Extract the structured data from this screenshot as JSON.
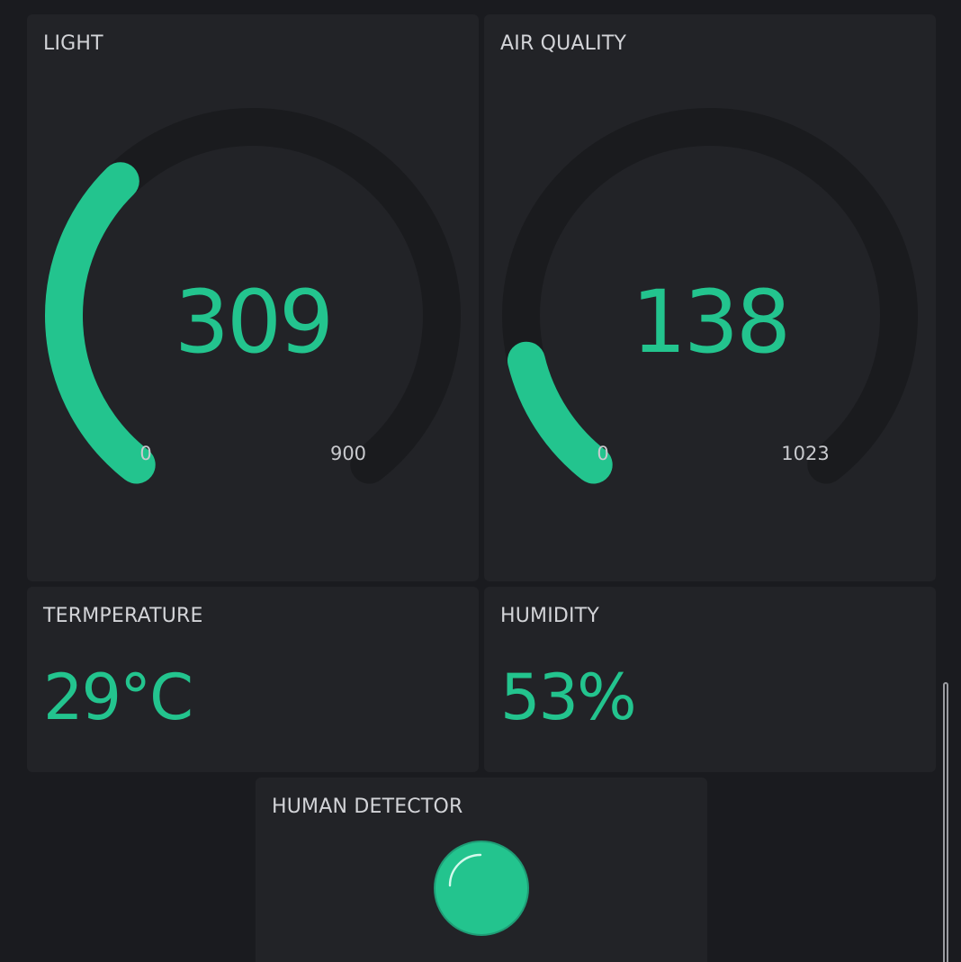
{
  "colors": {
    "accent": "#23c48e",
    "track": "#1a1b1e",
    "panel": "#222327",
    "background": "#1a1b1f",
    "title": "#d3d4d8"
  },
  "widgets": {
    "light": {
      "title": "LIGHT",
      "value": 309,
      "value_text": "309",
      "min": 0,
      "max": 900,
      "min_label": "0",
      "max_label": "900"
    },
    "air_quality": {
      "title": "AIR QUALITY",
      "value": 138,
      "value_text": "138",
      "min": 0,
      "max": 1023,
      "min_label": "0",
      "max_label": "1023"
    },
    "temperature": {
      "title": "TERMPERATURE",
      "value": "29°C"
    },
    "humidity": {
      "title": "HUMIDITY",
      "value": "53%"
    },
    "human_detector": {
      "title": "HUMAN DETECTOR",
      "led_state": "on"
    }
  }
}
